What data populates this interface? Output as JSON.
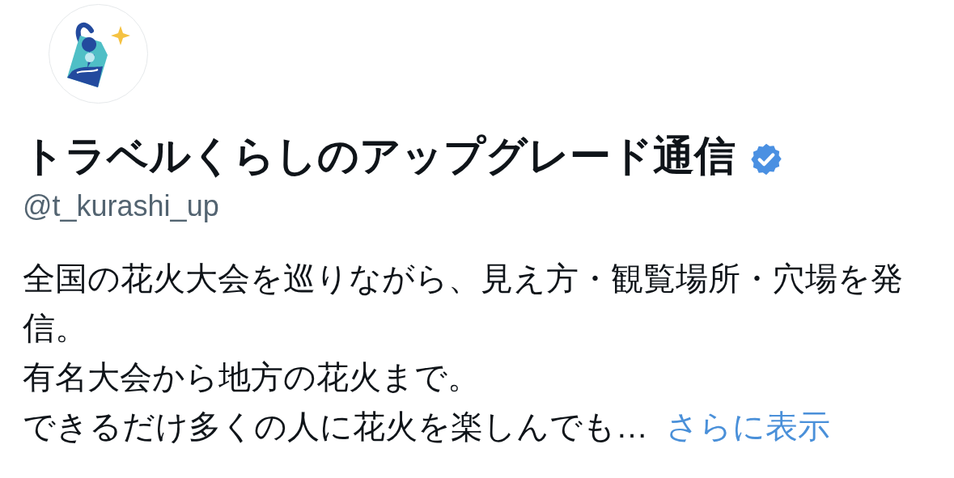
{
  "profile": {
    "name": "トラベルくらしのアップグレード通信",
    "verified": true,
    "handle": "@t_kurashi_up",
    "bio": [
      "全国の花火大会を巡りながら、見え方・観覧場所・穴場を発信。",
      "有名大会から地方の花火まで。",
      "できるだけ多くの人に花火を楽しんでも…"
    ],
    "more_link": "さらに表示"
  }
}
